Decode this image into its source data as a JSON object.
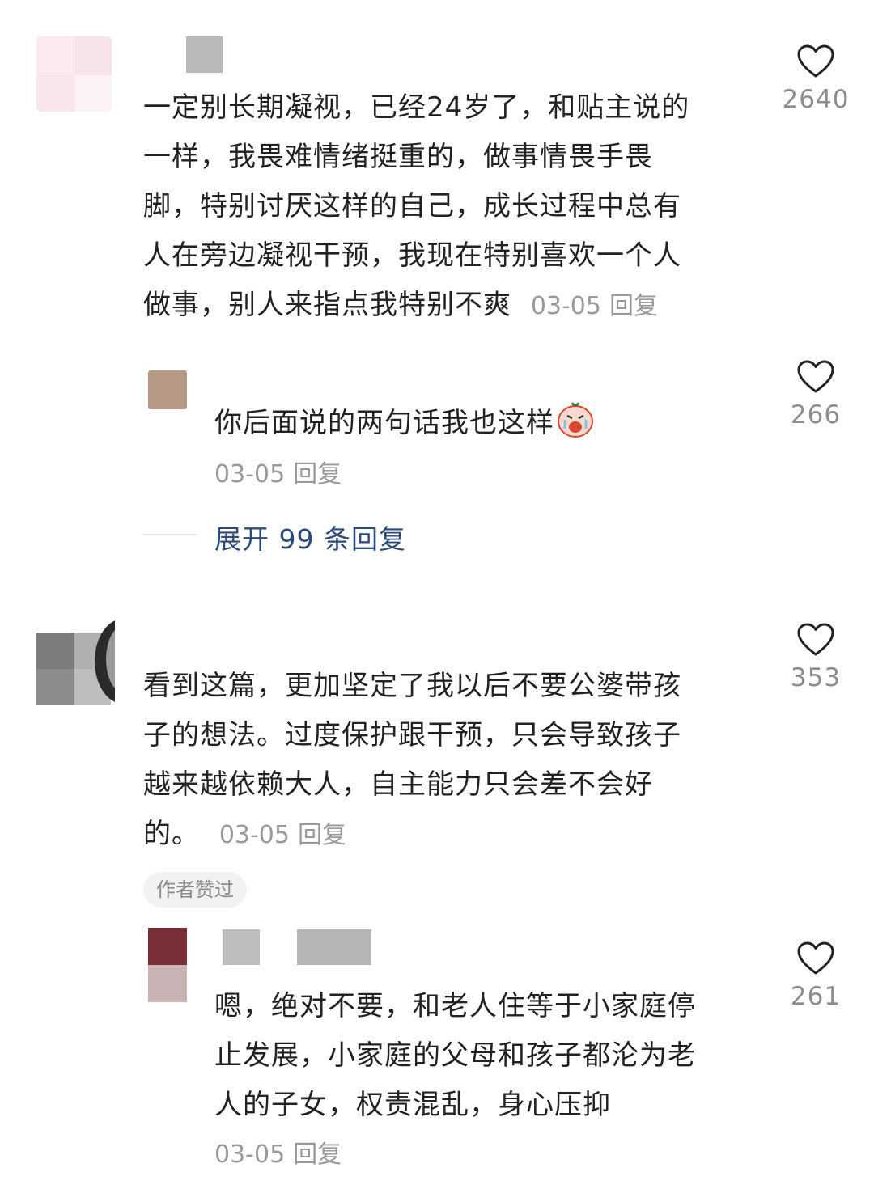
{
  "comments": [
    {
      "lines": [
        "一定别长期凝视，已经24岁了，和贴主说的",
        "一样，我畏难情绪挺重的，做事情畏手畏",
        "脚，特别讨厌这样的自己，成长过程中总有",
        "人在旁边凝视干预，我现在特别喜欢一个人",
        "做事，别人来指点我特别不爽"
      ],
      "date": "03-05",
      "reply_label": "回复",
      "likes": "2640",
      "sub_replies": [
        {
          "lines": [
            "你后面说的两句话我也这样"
          ],
          "emoji": "crying-face-emoji",
          "date": "03-05",
          "reply_label": "回复",
          "likes": "266"
        }
      ],
      "expand_label": "展开 99 条回复"
    },
    {
      "lines": [
        "看到这篇，更加坚定了我以后不要公婆带孩",
        "子的想法。过度保护跟干预，只会导致孩子",
        "越来越依赖大人，自主能力只会差不会好",
        "的。"
      ],
      "date": "03-05",
      "reply_label": "回复",
      "likes": "353",
      "badge": "作者赞过",
      "sub_replies": [
        {
          "lines": [
            "嗯，绝对不要，和老人住等于小家庭停",
            "止发展，小家庭的父母和孩子都沦为老",
            "人的子女，权责混乱，身心压抑"
          ],
          "date": "03-05",
          "reply_label": "回复",
          "likes": "261"
        }
      ]
    }
  ],
  "icons": {
    "like": "heart-outline-icon",
    "expand": "expand-replies-line"
  },
  "colors": {
    "text": "#222222",
    "meta": "#9a9a9a",
    "link": "#2c4a7a",
    "likes": "#8d8d8d"
  }
}
